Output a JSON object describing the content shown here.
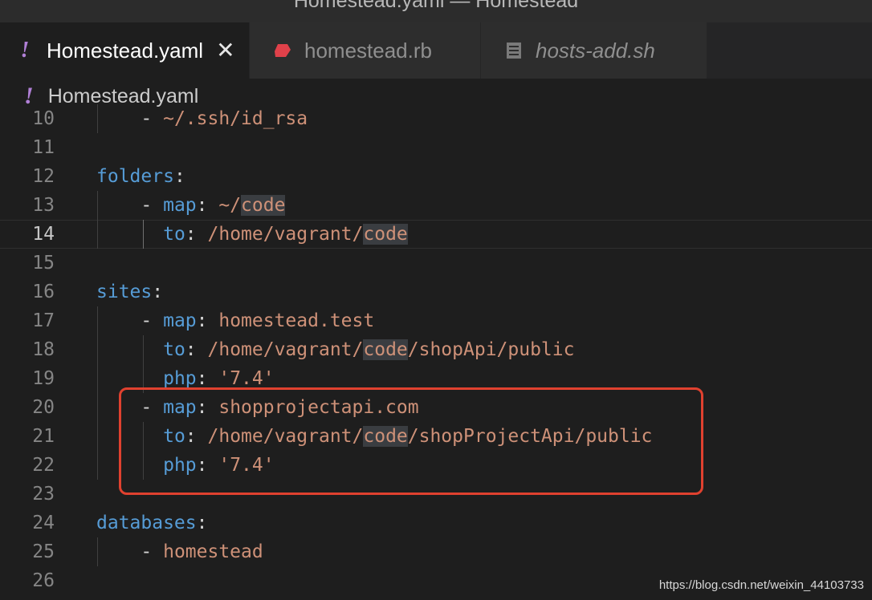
{
  "window": {
    "title": "Homestead.yaml — Homestead"
  },
  "tabs": [
    {
      "label": "Homestead.yaml",
      "icon": "yaml-exclamation-icon",
      "active": true
    },
    {
      "label": "homestead.rb",
      "icon": "ruby-gem-icon",
      "active": false
    },
    {
      "label": "hosts-add.sh",
      "icon": "shell-file-icon",
      "active": false,
      "preview": true
    }
  ],
  "breadcrumb": {
    "label": "Homestead.yaml"
  },
  "editor": {
    "current_line": 14,
    "lines": [
      {
        "n": "10",
        "tokens": [
          {
            "t": "    - ",
            "c": "p"
          },
          {
            "t": "~/.ssh/id_rsa",
            "c": "s"
          }
        ]
      },
      {
        "n": "11",
        "tokens": []
      },
      {
        "n": "12",
        "tokens": [
          {
            "t": "folders",
            "c": "k"
          },
          {
            "t": ":",
            "c": "p"
          }
        ]
      },
      {
        "n": "13",
        "tokens": [
          {
            "t": "    - ",
            "c": "p"
          },
          {
            "t": "map",
            "c": "k"
          },
          {
            "t": ": ",
            "c": "p"
          },
          {
            "t": "~/",
            "c": "s"
          },
          {
            "t": "code",
            "c": "s hl"
          }
        ]
      },
      {
        "n": "14",
        "tokens": [
          {
            "t": "      ",
            "c": "p"
          },
          {
            "t": "to",
            "c": "k"
          },
          {
            "t": ": ",
            "c": "p"
          },
          {
            "t": "/home/vagrant/",
            "c": "s"
          },
          {
            "t": "code",
            "c": "s hl"
          }
        ]
      },
      {
        "n": "15",
        "tokens": []
      },
      {
        "n": "16",
        "tokens": [
          {
            "t": "sites",
            "c": "k"
          },
          {
            "t": ":",
            "c": "p"
          }
        ]
      },
      {
        "n": "17",
        "tokens": [
          {
            "t": "    - ",
            "c": "p"
          },
          {
            "t": "map",
            "c": "k"
          },
          {
            "t": ": ",
            "c": "p"
          },
          {
            "t": "homestead.test",
            "c": "s"
          }
        ]
      },
      {
        "n": "18",
        "tokens": [
          {
            "t": "      ",
            "c": "p"
          },
          {
            "t": "to",
            "c": "k"
          },
          {
            "t": ": ",
            "c": "p"
          },
          {
            "t": "/home/vagrant/",
            "c": "s"
          },
          {
            "t": "code",
            "c": "s hl"
          },
          {
            "t": "/shopApi/public",
            "c": "s"
          }
        ]
      },
      {
        "n": "19",
        "tokens": [
          {
            "t": "      ",
            "c": "p"
          },
          {
            "t": "php",
            "c": "k"
          },
          {
            "t": ": ",
            "c": "p"
          },
          {
            "t": "'7.4'",
            "c": "s"
          }
        ]
      },
      {
        "n": "20",
        "tokens": [
          {
            "t": "    - ",
            "c": "p"
          },
          {
            "t": "map",
            "c": "k"
          },
          {
            "t": ": ",
            "c": "p"
          },
          {
            "t": "shopprojectapi.com",
            "c": "s"
          }
        ]
      },
      {
        "n": "21",
        "tokens": [
          {
            "t": "      ",
            "c": "p"
          },
          {
            "t": "to",
            "c": "k"
          },
          {
            "t": ": ",
            "c": "p"
          },
          {
            "t": "/home/vagrant/",
            "c": "s"
          },
          {
            "t": "code",
            "c": "s hl"
          },
          {
            "t": "/shopProjectApi/public",
            "c": "s"
          }
        ]
      },
      {
        "n": "22",
        "tokens": [
          {
            "t": "      ",
            "c": "p"
          },
          {
            "t": "php",
            "c": "k"
          },
          {
            "t": ": ",
            "c": "p"
          },
          {
            "t": "'7.4'",
            "c": "s"
          }
        ]
      },
      {
        "n": "23",
        "tokens": []
      },
      {
        "n": "24",
        "tokens": [
          {
            "t": "databases",
            "c": "k"
          },
          {
            "t": ":",
            "c": "p"
          }
        ]
      },
      {
        "n": "25",
        "tokens": [
          {
            "t": "    - ",
            "c": "p"
          },
          {
            "t": "homestead",
            "c": "s"
          }
        ]
      },
      {
        "n": "26",
        "tokens": []
      }
    ]
  },
  "watermark": "https://blog.csdn.net/weixin_44103733",
  "colors": {
    "editor_bg": "#1e1e1e",
    "key": "#569cd6",
    "string": "#ce9178",
    "annotation_box": "#e0412f",
    "yaml_icon": "#b180d7",
    "ruby_icon": "#e0414a"
  }
}
